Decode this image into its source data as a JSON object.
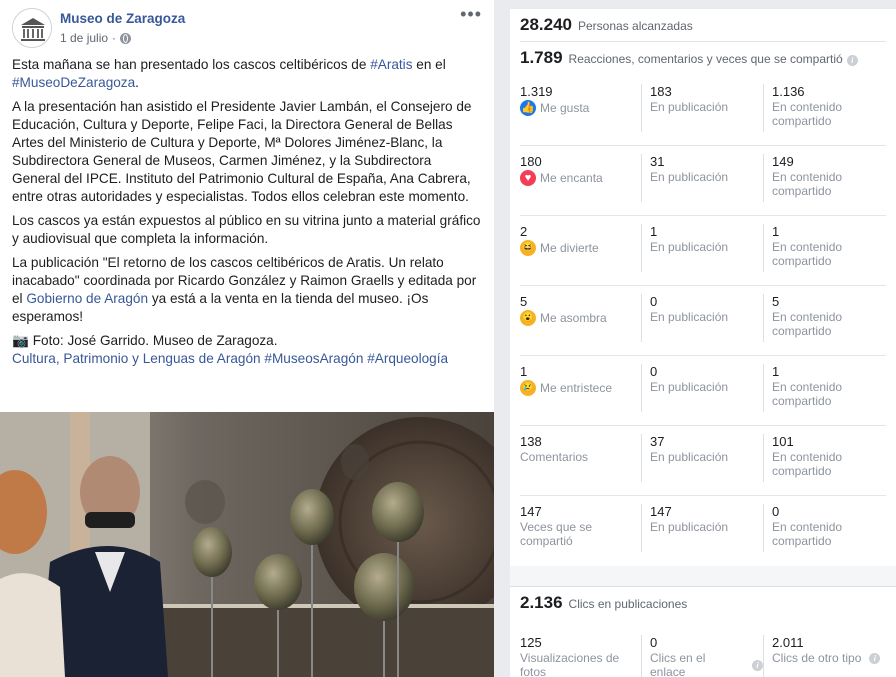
{
  "post": {
    "page_name": "Museo de Zaragoza",
    "date": "1 de julio",
    "dot": "·",
    "more": "•••",
    "p1_text": "Esta mañana se han presentado los cascos celtibéricos de ",
    "p1_tag1": "#Aratis",
    "p1_mid": " en el ",
    "p1_tag2": "#MuseoDeZaragoza",
    "p1_end": ".",
    "p2": "A la presentación han asistido el Presidente Javier Lambán, el Consejero de Educación, Cultura y Deporte, Felipe Faci, la Directora General de Bellas Artes del Ministerio de Cultura y Deporte, Mª Dolores Jiménez-Blanc, la Subdirectora General de Museos, Carmen Jiménez, y la Subdirectora General del IPCE. Instituto del Patrimonio Cultural de España, Ana Cabrera, entre otras autoridades y especialistas. Todos ellos celebran este momento.",
    "p3": "Los cascos ya están expuestos al público en su vitrina junto a material gráfico y audiovisual que completa la información.",
    "p4_start": "La publicación \"El retorno de los cascos celtibéricos de Aratis. Un relato inacabado\" coordinada por Ricardo González y Raimon Graells y editada por el ",
    "p4_link": "Gobierno de Aragón",
    "p4_end": " ya está a la venta en la tienda del museo. ¡Os esperamos!",
    "p5_camera": "📷",
    "p5": " Foto: José Garrido. Museo de Zaragoza.",
    "p6_link": "Cultura, Patrimonio y Lenguas de Aragón",
    "p6_tag1": "#MuseosAragón",
    "p6_tag2": "#Arqueología"
  },
  "insights": {
    "reach": {
      "number": "28.240",
      "label": "Personas alcanzadas"
    },
    "engagement": {
      "number": "1.789",
      "label": "Reacciones, comentarios y veces que se compartió"
    },
    "rows": [
      {
        "total": "1.319",
        "label": "Me gusta",
        "icon": "like-icon",
        "glyph": "👍",
        "cls": "r-like",
        "in_post": "183",
        "in_post_label": "En publicación",
        "shared": "1.136",
        "shared_label": "En contenido compartido"
      },
      {
        "total": "180",
        "label": "Me encanta",
        "icon": "love-icon",
        "glyph": "♥",
        "cls": "r-love",
        "in_post": "31",
        "in_post_label": "En publicación",
        "shared": "149",
        "shared_label": "En contenido compartido"
      },
      {
        "total": "2",
        "label": "Me divierte",
        "icon": "haha-icon",
        "glyph": "😆",
        "cls": "r-haha",
        "in_post": "1",
        "in_post_label": "En publicación",
        "shared": "1",
        "shared_label": "En contenido compartido"
      },
      {
        "total": "5",
        "label": "Me asombra",
        "icon": "wow-icon",
        "glyph": "😮",
        "cls": "r-wow",
        "in_post": "0",
        "in_post_label": "En publicación",
        "shared": "5",
        "shared_label": "En contenido compartido"
      },
      {
        "total": "1",
        "label": "Me entristece",
        "icon": "sad-icon",
        "glyph": "😢",
        "cls": "r-sad",
        "in_post": "0",
        "in_post_label": "En publicación",
        "shared": "1",
        "shared_label": "En contenido compartido"
      },
      {
        "total": "138",
        "label": "Comentarios",
        "icon": "",
        "glyph": "",
        "cls": "",
        "in_post": "37",
        "in_post_label": "En publicación",
        "shared": "101",
        "shared_label": "En contenido compartido"
      },
      {
        "total": "147",
        "label": "Veces que se compartió",
        "icon": "",
        "glyph": "",
        "cls": "",
        "in_post": "147",
        "in_post_label": "En publicación",
        "shared": "0",
        "shared_label": "En contenido compartido"
      }
    ],
    "clicks": {
      "number": "2.136",
      "label": "Clics en publicaciones",
      "photo_views": "125",
      "photo_views_label": "Visualizaciones de fotos",
      "link_clicks": "0",
      "link_clicks_label": "Clics en el enlace",
      "other_clicks": "2.011",
      "other_clicks_label": "Clics de otro tipo"
    },
    "info_glyph": "i"
  }
}
